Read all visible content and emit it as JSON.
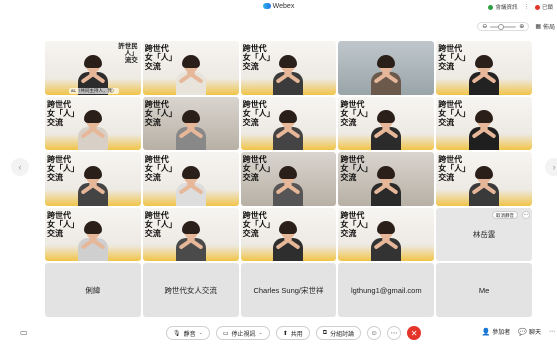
{
  "app": {
    "title": "Webex"
  },
  "top_right": {
    "meeting_info": "會議資訊",
    "locked": "已鎖"
  },
  "toolbar": {
    "layout_label": "佈局"
  },
  "sign_text": "跨世代\n女「人」\n交流",
  "tiles": [
    {
      "caption": "aL（共同主持人，我）",
      "sign": "許世民\n人」\n流交"
    },
    {},
    {},
    {},
    {},
    {},
    {},
    {},
    {},
    {},
    {},
    {},
    {},
    {},
    {},
    {},
    {},
    {},
    {}
  ],
  "highlight_tile": {
    "name": "林岳霆",
    "unmute_label": "取消靜音"
  },
  "name_tiles": [
    "俐緯",
    "跨世代女人交流",
    "Charles Sung/宋世祥",
    "lgthung1@gmail.com",
    "Me"
  ],
  "bottom": {
    "mute_label": "靜音",
    "stop_video_label": "停止視訊",
    "share_label": "共用",
    "breakout_label": "分組討論",
    "participants_label": "參加者",
    "chat_label": "聊天"
  },
  "colors": {
    "end_red": "#e5352b",
    "brand": "#1a73e8"
  }
}
